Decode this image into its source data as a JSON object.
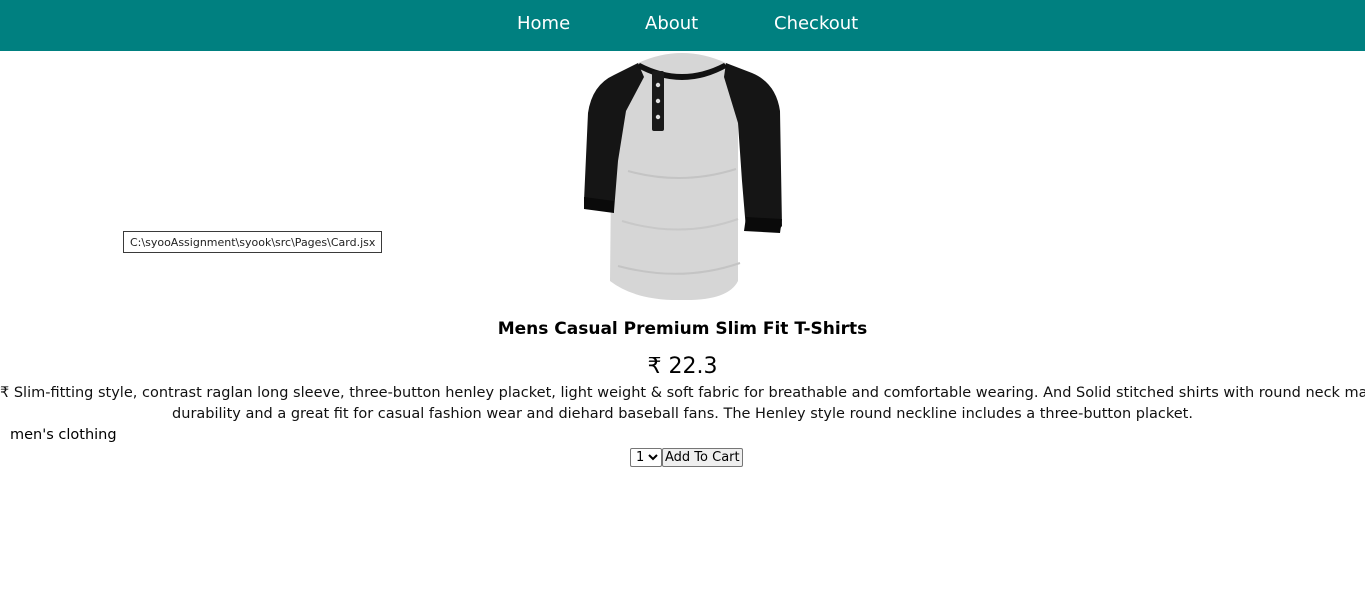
{
  "nav": {
    "home": "Home",
    "about": "About",
    "checkout": "Checkout",
    "bar_color": "#008080"
  },
  "tooltip": {
    "text": "C:\\syooAssignment\\syook\\src\\Pages\\Card.jsx"
  },
  "product": {
    "image_icon": "raglan-henley-tshirt-image",
    "title": "Mens Casual Premium Slim Fit T-Shirts",
    "price": "₹ 22.3",
    "description_line1": "₹ Slim-fitting style, contrast raglan long sleeve, three-button henley placket, light weight & soft fabric for breathable and comfortable wearing. And Solid stitched shirts with round neck made for",
    "description_line2": "durability and a great fit for casual fashion wear and diehard baseball fans. The Henley style round neckline includes a three-button placket.",
    "category": "men's clothing"
  },
  "cart": {
    "quantity_selected": "1",
    "quantity_options": [
      "1"
    ],
    "add_label": "Add To Cart"
  }
}
